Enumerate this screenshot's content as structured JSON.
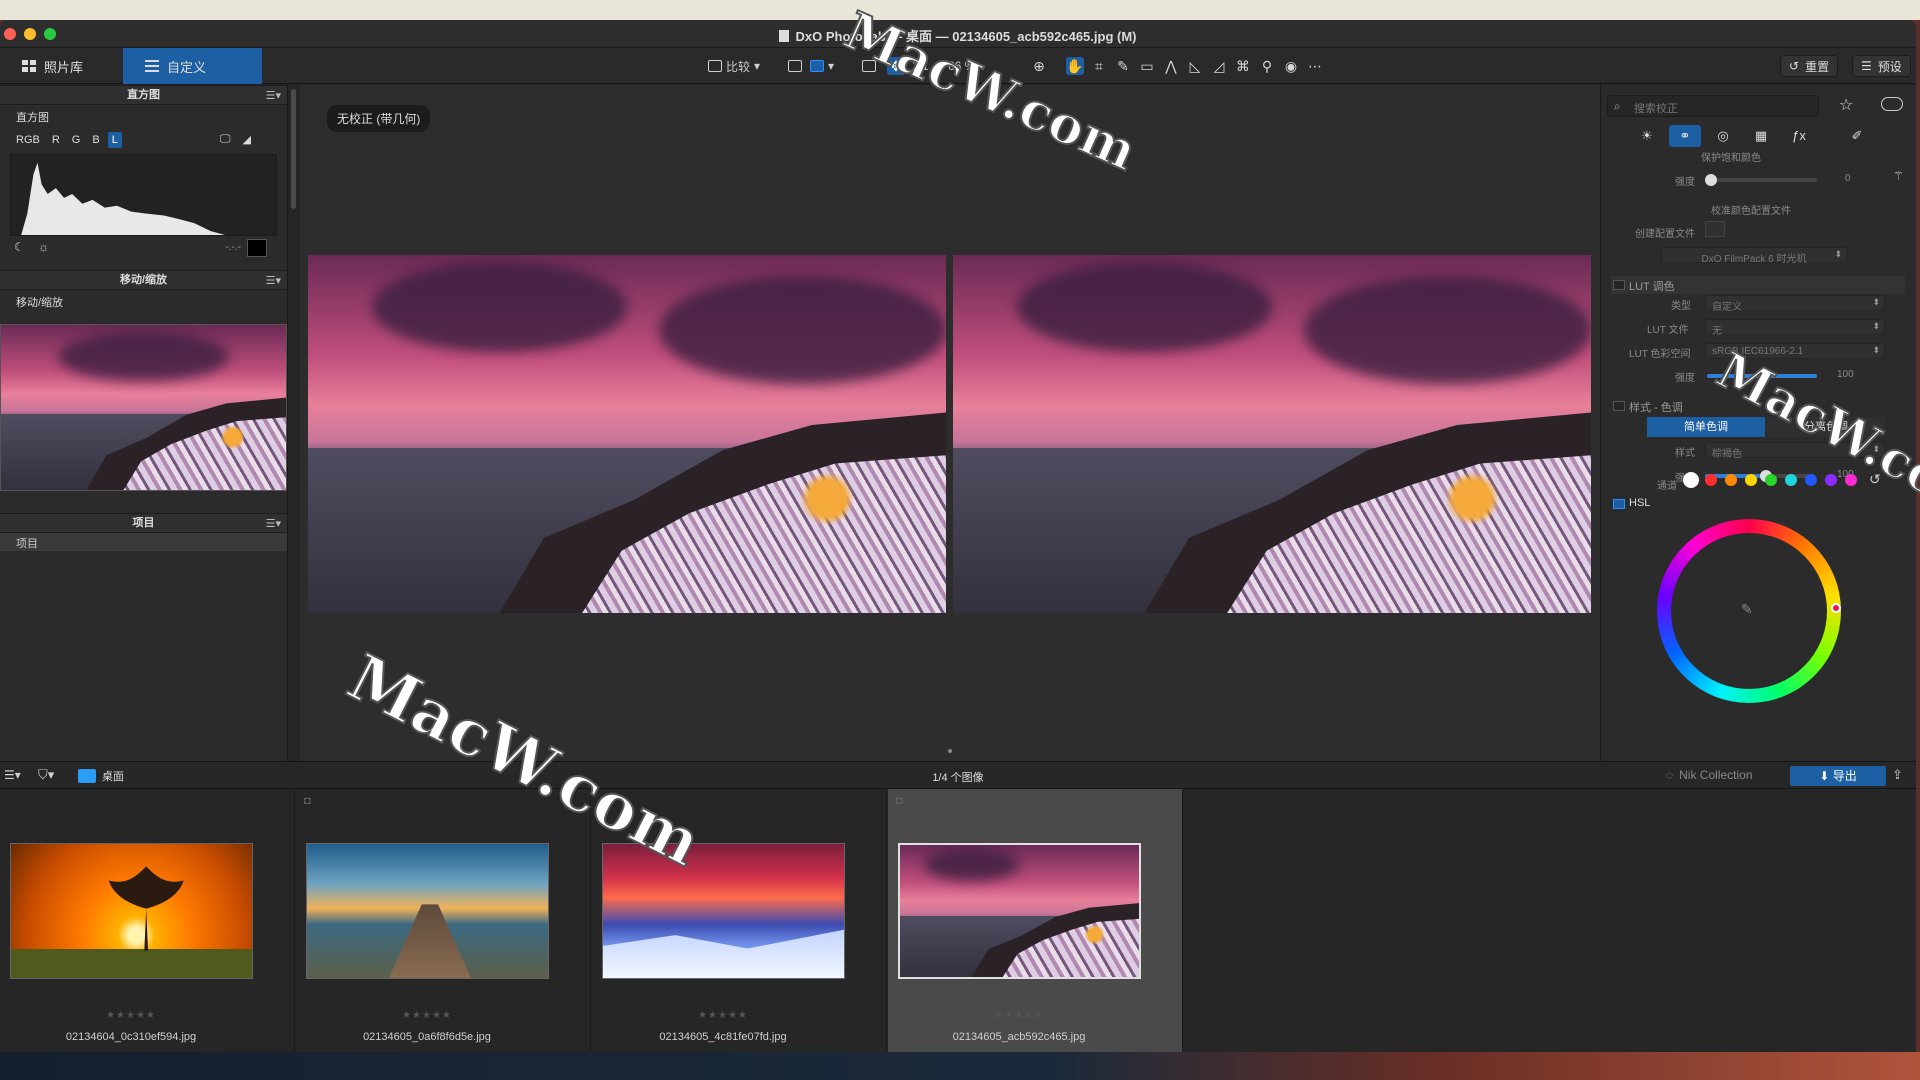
{
  "window": {
    "title": "DxO PhotoLab — 桌面 — 02134605_acb592c465.jpg (M)"
  },
  "toolbar": {
    "tab_library": "照片库",
    "tab_customize": "自定义",
    "compare_label": "比较",
    "zoom_1to1": "1:1",
    "zoom_pct": "66 %",
    "reset_label": "重置",
    "preset_label": "预设"
  },
  "left_panel": {
    "histogram_header": "直方图",
    "histogram_sub": "直方图",
    "channels": [
      "RGB",
      "R",
      "G",
      "B",
      "L"
    ],
    "active_channel": "L",
    "readout": "-.-.-",
    "move_zoom_header": "移动/缩放",
    "move_zoom_sub": "移动/缩放",
    "project_header": "项目",
    "project_sub": "项目"
  },
  "viewer": {
    "badge": "无校正 (带几何)"
  },
  "right_panel": {
    "search_placeholder": "搜索校正",
    "protect_colors": "保护饱和颜色",
    "intensity_label": "强度",
    "intensity_value": "0",
    "calibrate_profile": "校准颜色配置文件",
    "create_profile": "创建配置文件",
    "filmpack_button": "DxO FilmPack 6 时光机",
    "lut_header": "LUT 调色",
    "lut_type_label": "类型",
    "lut_type_value": "自定义",
    "lut_file_label": "LUT 文件",
    "lut_file_value": "无",
    "lut_space_label": "LUT 色彩空间",
    "lut_space_value": "sRGB IEC61966-2.1",
    "lut_strength_label": "强度",
    "lut_strength_value": "100",
    "style_header": "样式 - 色调",
    "seg_simple": "简单色调",
    "seg_split": "分离色调",
    "style_label": "样式",
    "style_value": "棕褐色",
    "style_strength_label": "强度",
    "style_strength_value": "100",
    "hsl_header": "HSL",
    "channel_label": "通道",
    "channel_colors": [
      "#ffffff",
      "#ff2d2d",
      "#ff8a00",
      "#ffd400",
      "#2bd42b",
      "#1ed4e0",
      "#2456ff",
      "#8a2cff",
      "#ff2bd0"
    ]
  },
  "filmstrip": {
    "folder": "桌面",
    "count": "1/4 个图像",
    "nik": "Nik Collection",
    "export": "导出",
    "items": [
      {
        "name": "02134604_0c310ef594.jpg",
        "stars": "★★★★★"
      },
      {
        "name": "02134605_0a6f8f6d5e.jpg",
        "stars": "★★★★★"
      },
      {
        "name": "02134605_4c81fe07fd.jpg",
        "stars": "★★★★★"
      },
      {
        "name": "02134605_acb592c465.jpg",
        "stars": "★★★★★"
      }
    ]
  },
  "watermark": "MacW.com",
  "colors": {
    "accent": "#1d5fa3",
    "panel": "#2b2b2b",
    "viewer": "#2d2d2d"
  }
}
